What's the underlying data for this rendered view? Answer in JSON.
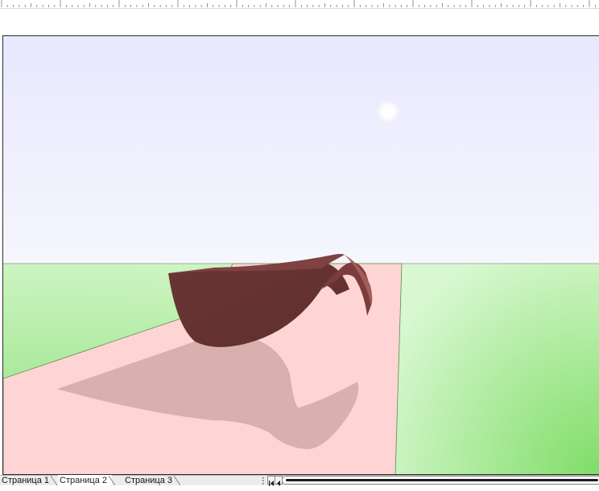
{
  "window": {
    "ruler_label": "Horizontal ruler"
  },
  "scene": {
    "description_labels": [],
    "colors": {
      "sky_top": "#e8e8fe",
      "sky_bottom": "#f6f6fe",
      "grass_light": "#d4f7cc",
      "grass_dark": "#7fdd66",
      "floor": "#ffd4d4",
      "object": "#683433",
      "object_edge": "#9a5553",
      "shadow": "#d8b0b0",
      "sun": "#ffffff"
    }
  },
  "tabs": [
    {
      "label": "Страница 1",
      "active": false
    },
    {
      "label": "Страница 2",
      "active": true
    },
    {
      "label": "Страница 3",
      "active": false
    }
  ],
  "statusbar": {
    "scroll_position": 0
  }
}
